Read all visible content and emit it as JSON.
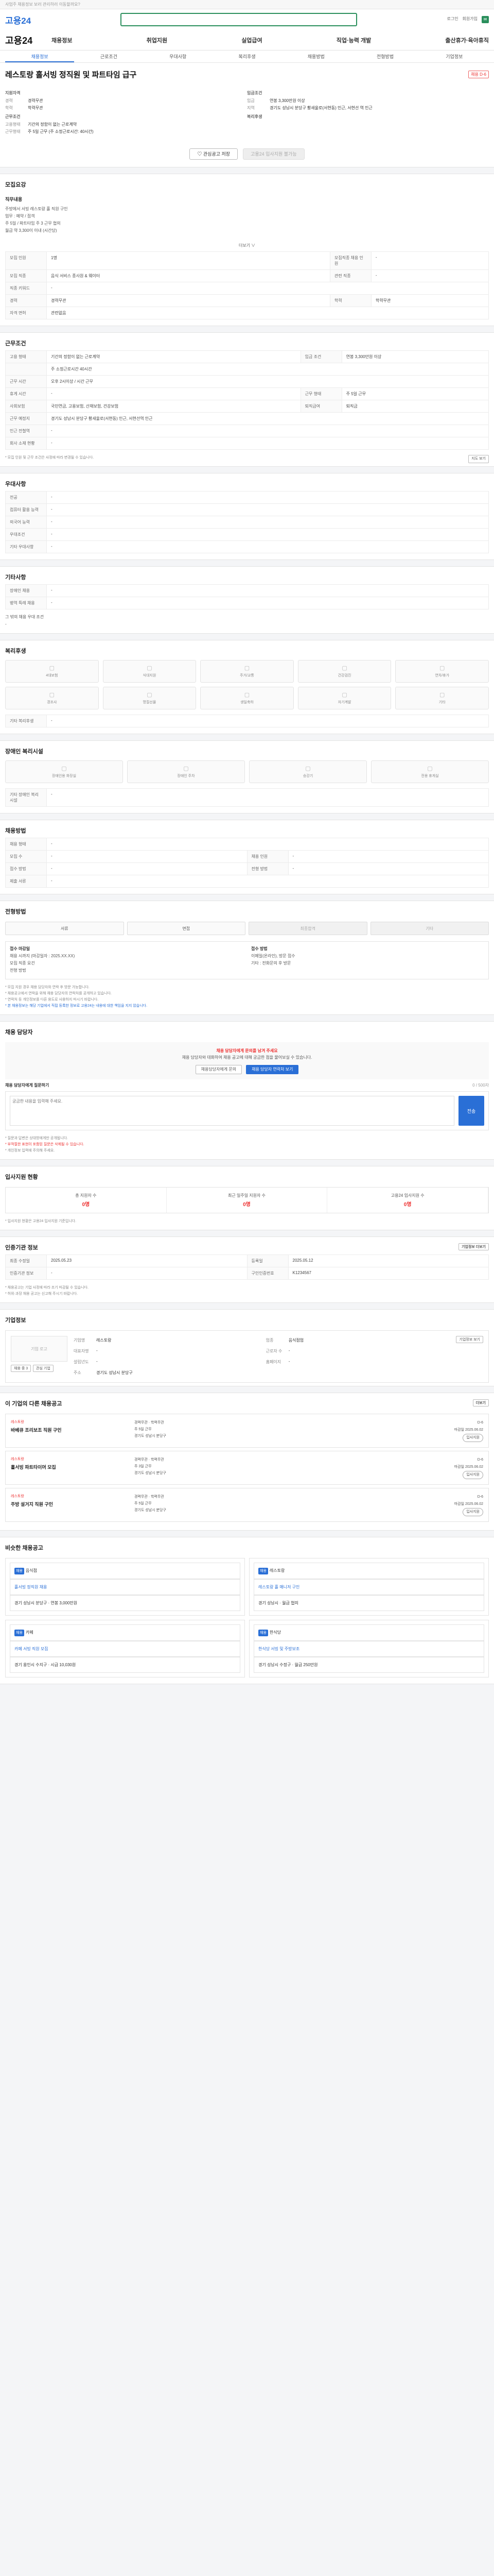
{
  "topbar": {
    "note": "사업주 채용정보 보러 관리하러 이동할까요?"
  },
  "header": {
    "logo": "고용24",
    "links": [
      "로그인",
      "회원가입"
    ],
    "search_placeholder": ""
  },
  "gnb": {
    "brand": "고용24",
    "menu": [
      "채용정보",
      "취업지원",
      "실업급여",
      "직업·능력 개발",
      "출산휴가·육아휴직"
    ]
  },
  "subnav": {
    "items": [
      "채용정보",
      "근로조건",
      "우대사항",
      "복리후생",
      "채용방법",
      "전형방법",
      "기업정보"
    ],
    "active": 0
  },
  "job": {
    "title": "레스토랑 홀서빙 정직원 및 파트타임 급구",
    "badge": "채용 D-6",
    "left_head": "지원자격",
    "left": [
      {
        "k": "경력",
        "v": "경력무관"
      },
      {
        "k": "학력",
        "v": "학력무관"
      }
    ],
    "left_head2": "근무조건",
    "left2": [
      {
        "k": "고용형태",
        "v": "기간의 정함이 없는 근로계약"
      },
      {
        "k": "근무형태",
        "v": "주 5일 근무 (주 소정근로시간: 40시간)"
      }
    ],
    "right_head": "임금조건",
    "right": [
      {
        "k": "임금",
        "v": "연봉 3,300만원 이상"
      },
      {
        "k": "지역",
        "v": "경기도 성남시 분당구 황새울로(서현동) 인근, 서현선 역 인근"
      }
    ],
    "right_head2": "복리후생",
    "right2": []
  },
  "buttons": {
    "scrap": "관심공고 저장",
    "apply": "고용24 입사지원 불가능"
  },
  "intro": {
    "title": "모집요강",
    "sub": "직무내용",
    "text": [
      "주방에서 서빙 레스토랑 홀 직원 구인",
      "업무 : 예약 / 접객",
      "주 5일 / 파트타임 주 3 근무 협의",
      "월급 약 3,300이 이내 (시간당)"
    ],
    "more": "더보기 ∨"
  },
  "conditions": [
    {
      "k": "모집 인원",
      "v": "1명",
      "k2": "모집직종 채용 인원",
      "v2": "-"
    },
    {
      "k": "모집 직종",
      "v": "음식 서비스 종사원 & 웨이터",
      "k2": "관련 직종",
      "v2": "-"
    },
    {
      "k": "직종 키워드",
      "v": "-",
      "k2": "",
      "v2": ""
    },
    {
      "k": "경력",
      "v": "경력무관",
      "k2": "학력",
      "v2": "학력무관"
    },
    {
      "k": "자격 면허",
      "v": "관련없음",
      "k2": "",
      "v2": ""
    }
  ],
  "work_title": "근무조건",
  "work": [
    {
      "k": "고용 형태",
      "v": "기간의 정함이 없는 근로계약",
      "k2": "임금 조건",
      "v2": "연봉 3,300만원 이상"
    },
    {
      "k": "",
      "v": "주 소정근로시간 40시간",
      "k2": "",
      "v2": ""
    },
    {
      "k": "근무 시간",
      "v": "오후 2시이상  / 시간 근무",
      "k2": "",
      "v2": ""
    },
    {
      "k": "휴게 시간",
      "v": "-",
      "k2": "근무 형태",
      "v2": "주 5일 근무"
    },
    {
      "k": "사회보험",
      "v": "국민연금, 고용보험, 산재보험, 건강보험",
      "k2": "퇴직급여",
      "v2": "퇴직금"
    },
    {
      "k": "근무 예정지",
      "v": "경기도 성남시 분당구 황새울로(서현동) 인근, 서현선역 인근",
      "k2": "",
      "v2": ""
    },
    {
      "k": "인근 전철역",
      "v": "-",
      "k2": "",
      "v2": ""
    },
    {
      "k": "회사 소재 현황",
      "v": "-",
      "k2": "",
      "v2": ""
    }
  ],
  "work_note": "* 모집 인원 및 근무 조건은 사정에 따라 변경될 수 있습니다.",
  "work_map": "지도 보기",
  "prefer": {
    "title": "우대사항",
    "rows": [
      {
        "k": "전공",
        "v": "-"
      },
      {
        "k": "컴퓨터 활용 능력",
        "v": "-"
      },
      {
        "k": "외국어 능력",
        "v": "-"
      },
      {
        "k": "우대조건",
        "v": "-"
      },
      {
        "k": "기타 우대사항",
        "v": "-"
      }
    ]
  },
  "etc": {
    "title": "기타사항",
    "rows": [
      {
        "k": "장애인 채용",
        "v": "-"
      },
      {
        "k": "병역 특례 채용",
        "v": "-"
      }
    ],
    "note": "그 밖의 채용 우대 조건",
    "note_v": "-"
  },
  "welfare": {
    "title": "복리후생",
    "tiles": [
      "4대보험",
      "식대지원",
      "주거/교통",
      "건강검진",
      "연차/휴가",
      "경조사",
      "명절선물",
      "생일축하",
      "자기계발",
      "기타"
    ],
    "other": "기타 복리후생",
    "other_v": "-"
  },
  "disabled": {
    "title": "장애인 복리시설",
    "tiles": [
      "장애인용 화장실",
      "장애인 주차",
      "승강기",
      "전용 휴게실"
    ],
    "other": "기타 장애인 복리시설",
    "other_v": "-"
  },
  "method": {
    "title": "채용방법",
    "rows": [
      {
        "k": "채용 형태",
        "v": "-"
      },
      {
        "k": "모집 수",
        "v": "-",
        "k2": "채용 인원",
        "v2": "-"
      },
      {
        "k": "접수 방법",
        "v": "-",
        "k2": "전형 방법",
        "v2": "-"
      },
      {
        "k": "제출 서류",
        "v": "-"
      }
    ]
  },
  "select": {
    "title": "전형방법",
    "steps": [
      "서류",
      "면접",
      "최종합격",
      "기타"
    ],
    "box1_h": "접수 마감일",
    "box1": [
      "채용 시까지 (마감일자 : 2025.XX.XX)",
      "모집 직종 요건",
      "전형 방법"
    ],
    "box2_h": "접수 방법",
    "box2": [
      "이메일(온라인), 방문 접수 ",
      "기타 : 전화문의 후 방문"
    ],
    "notes": [
      "* 모집 지원 경우 채용 담당자와 연락 후 방문 가능합니다.",
      "* 채용공고에서 연락을 위해 채용 담당자의 연락처를 공개하고 있습니다.",
      "* 연락처 등 개인정보를 다른 용도로 사용하지 마시기 바랍니다.",
      "* 본 채용정보는 해당 기업에서 직접 등록한 정보로 고용24는 내용에 대한 책임을 지지 않습니다."
    ]
  },
  "contact": {
    "title": "채용 담당자",
    "head": "채용 담당자에게 문의를 남겨 주세요",
    "text": "채용 담당자와 대화하여 채용 공고에 대해 궁금한 점을 물어보실 수 있습니다.",
    "btn1": "채용담당자에게 문의",
    "btn2": "채용 담당자 연락처 보기",
    "qa_h": "채용 담당자에게 질문하기",
    "qa_count": "0 / 500자",
    "qa_placeholder": "궁금한 내용을 입력해 주세요.",
    "send": "전송",
    "notes": [
      "* 질문과 답변은 상대방에게만 공개됩니다.",
      "* 부적절한 표현이 포함된 질문은 삭제될 수 있습니다.",
      "* 개인정보 입력에 주의해 주세요."
    ]
  },
  "stats": {
    "title": "입사지원 현황",
    "items": [
      {
        "k": "총 지원자 수",
        "v": "0명"
      },
      {
        "k": "최근 일주일 지원자 수",
        "v": "0명"
      },
      {
        "k": "고용24 입사지원 수",
        "v": "0명"
      }
    ],
    "note": "* 입사지원 현황은 고용24 입사지원 기준입니다."
  },
  "recruit": {
    "title": "인증기관 정보",
    "btn": "기업정보 더보기",
    "rows": [
      {
        "k": "최종 수정일",
        "v": "2025.05.23",
        "k2": "등록일",
        "v2": "2025.05.12"
      },
      {
        "k": "인증기관 정보",
        "v": "-",
        "k2": "구인인증번호",
        "v2": "K1234567"
      }
    ],
    "notes": [
      "* 채용공고는 기업 사정에 따라 조기 마감될 수 있습니다.",
      "* 허위·과장 채용 공고는 신고해 주시기 바랍니다."
    ]
  },
  "company": {
    "title": "기업정보",
    "logo": "기업 로고",
    "btn": "기업정보 보기",
    "fields": [
      {
        "k": "기업명",
        "v": "레스토랑"
      },
      {
        "k": "업종",
        "v": "음식점업"
      },
      {
        "k": "대표자명",
        "v": "-"
      },
      {
        "k": "근로자 수",
        "v": "-"
      },
      {
        "k": "설립년도",
        "v": "-"
      },
      {
        "k": "홈페이지",
        "v": "-"
      },
      {
        "k": "주소",
        "v": "경기도 성남시 분당구"
      }
    ],
    "tags": [
      "채용 중 3",
      "관심 기업"
    ]
  },
  "others": {
    "title": "이 기업의 다른 채용공고",
    "more": "더보기",
    "jobs": [
      {
        "co": "레스토랑",
        "title": "바베큐 조리보조 직원 구인",
        "m": [
          "경력무관 · 학력무관",
          "주 5일 근무",
          "경기도 성남시 분당구"
        ],
        "r": [
          "D-6",
          "마감일 2025.06.02"
        ],
        "pill": "입사지원"
      },
      {
        "co": "레스토랑",
        "title": "홀서빙 파트타이머 모집",
        "m": [
          "경력무관 · 학력무관",
          "주 3일 근무",
          "경기도 성남시 분당구"
        ],
        "r": [
          "D-6",
          "마감일 2025.06.02"
        ],
        "pill": "입사지원"
      },
      {
        "co": "레스토랑",
        "title": "주방 설거지 직원 구인",
        "m": [
          "경력무관 · 학력무관",
          "주 5일 근무",
          "경기도 성남시 분당구"
        ],
        "r": [
          "D-6",
          "마감일 2025.06.02"
        ],
        "pill": "입사지원"
      }
    ]
  },
  "similar": {
    "title": "비슷한 채용공고",
    "items": [
      {
        "tag": "채용",
        "co": "음식점",
        "title": "홀서빙 정직원 채용",
        "info": "경기 성남시 분당구 · 연봉 3,000만원"
      },
      {
        "tag": "채용",
        "co": "레스토랑",
        "title": "레스토랑 홀 매니저 구인",
        "info": "경기 성남시 · 월급 협의"
      },
      {
        "tag": "채용",
        "co": "카페",
        "title": "카페 서빙 직원 모집",
        "info": "경기 용인시 수지구 · 시급 10,030원"
      },
      {
        "tag": "채용",
        "co": "한식당",
        "title": "한식당 서빙 및 주방보조",
        "info": "경기 성남시 수정구 · 월급 250만원"
      }
    ]
  }
}
